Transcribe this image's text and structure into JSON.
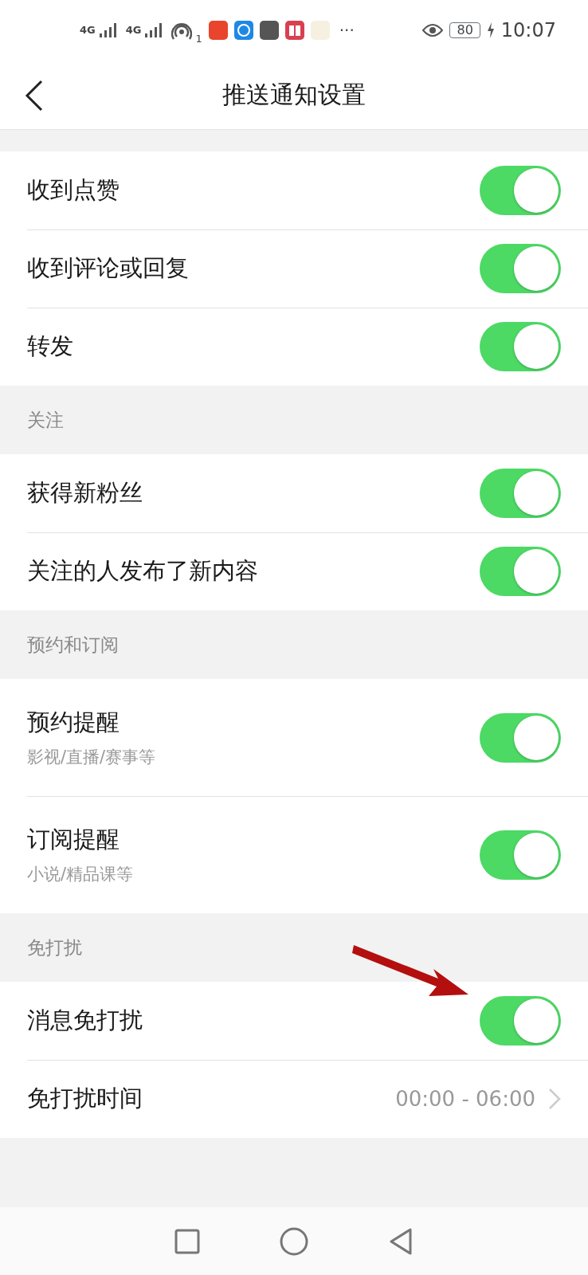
{
  "status_bar": {
    "sim_1": "4G",
    "sim_2": "4G",
    "hotspot_count": "1",
    "more": "···",
    "battery": "80",
    "time": "10:07"
  },
  "header": {
    "title": "推送通知设置"
  },
  "sections": [
    {
      "rows": [
        {
          "label": "收到点赞",
          "kind": "toggle",
          "on": true
        },
        {
          "label": "收到评论或回复",
          "kind": "toggle",
          "on": true
        },
        {
          "label": "转发",
          "kind": "toggle",
          "on": true
        }
      ]
    },
    {
      "title": "关注",
      "rows": [
        {
          "label": "获得新粉丝",
          "kind": "toggle",
          "on": true
        },
        {
          "label": "关注的人发布了新内容",
          "kind": "toggle",
          "on": true
        }
      ]
    },
    {
      "title": "预约和订阅",
      "rows": [
        {
          "label": "预约提醒",
          "subtitle": "影视/直播/赛事等",
          "kind": "toggle",
          "on": true
        },
        {
          "label": "订阅提醒",
          "subtitle": "小说/精品课等",
          "kind": "toggle",
          "on": true
        }
      ]
    },
    {
      "title": "免打扰",
      "rows": [
        {
          "label": "消息免打扰",
          "kind": "toggle",
          "on": true,
          "annotated": true
        },
        {
          "label": "免打扰时间",
          "kind": "link",
          "value": "00:00 - 06:00"
        }
      ]
    }
  ]
}
